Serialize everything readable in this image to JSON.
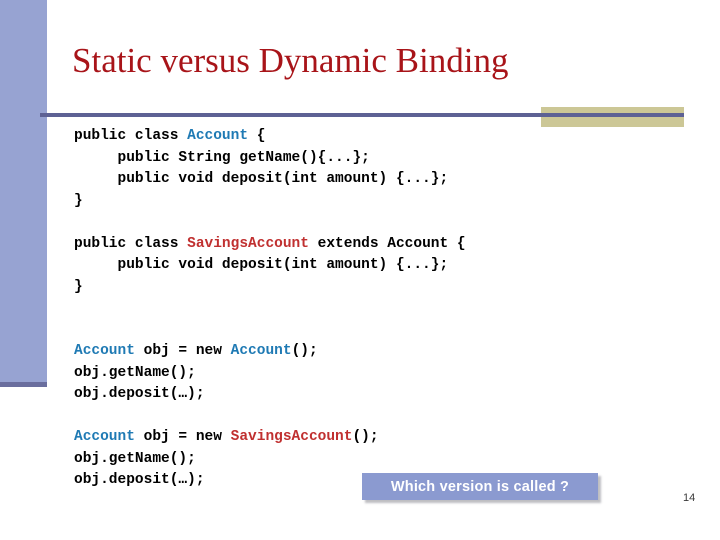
{
  "slide": {
    "title": "Static versus Dynamic Binding",
    "number": "14",
    "colors": {
      "title": "#a81419",
      "left_bar": "#97a3d2",
      "left_bar_foot": "#6a6e9e",
      "rule": "#5d6194",
      "accent_block": "#ccc796",
      "callout_bg": "#8b9ad0",
      "callout_text": "#ffffff",
      "code_black": "#000000",
      "code_blue": "#1f7ab4",
      "code_red": "#c03030",
      "background": "#ffffff"
    }
  },
  "code": {
    "blocks": [
      {
        "id": "account-class",
        "lines": [
          {
            "segments": [
              {
                "text": "public class ",
                "color": "black"
              },
              {
                "text": "Account",
                "color": "blue"
              },
              {
                "text": " {",
                "color": "black"
              }
            ]
          },
          {
            "segments": [
              {
                "text": "     public String getName(){...};",
                "color": "black"
              }
            ]
          },
          {
            "segments": [
              {
                "text": "     public void deposit(int amount) {...};",
                "color": "black"
              }
            ]
          },
          {
            "segments": [
              {
                "text": "}",
                "color": "black"
              }
            ]
          }
        ]
      },
      {
        "id": "savingsaccount-class",
        "lines": [
          {
            "segments": [
              {
                "text": "public class ",
                "color": "black"
              },
              {
                "text": "SavingsAccount",
                "color": "red"
              },
              {
                "text": " extends Account {",
                "color": "black"
              }
            ]
          },
          {
            "segments": [
              {
                "text": "     public void deposit(int amount) {...};",
                "color": "black"
              }
            ]
          },
          {
            "segments": [
              {
                "text": "}",
                "color": "black"
              }
            ]
          }
        ]
      },
      {
        "id": "static-binding-usage",
        "lines": [
          {
            "segments": [
              {
                "text": "Account",
                "color": "blue"
              },
              {
                "text": " obj = new ",
                "color": "black"
              },
              {
                "text": "Account",
                "color": "blue"
              },
              {
                "text": "();",
                "color": "black"
              }
            ]
          },
          {
            "segments": [
              {
                "text": "obj.getName();",
                "color": "black"
              }
            ]
          },
          {
            "segments": [
              {
                "text": "obj.deposit(…);",
                "color": "black"
              }
            ]
          }
        ]
      },
      {
        "id": "dynamic-binding-usage",
        "lines": [
          {
            "segments": [
              {
                "text": "Account",
                "color": "blue"
              },
              {
                "text": " obj = new ",
                "color": "black"
              },
              {
                "text": "SavingsAccount",
                "color": "red"
              },
              {
                "text": "();",
                "color": "black"
              }
            ]
          },
          {
            "segments": [
              {
                "text": "obj.getName();",
                "color": "black"
              }
            ]
          },
          {
            "segments": [
              {
                "text": "obj.deposit(…);",
                "color": "black"
              }
            ]
          }
        ]
      }
    ]
  },
  "callout": {
    "text": "Which version is called ?"
  }
}
